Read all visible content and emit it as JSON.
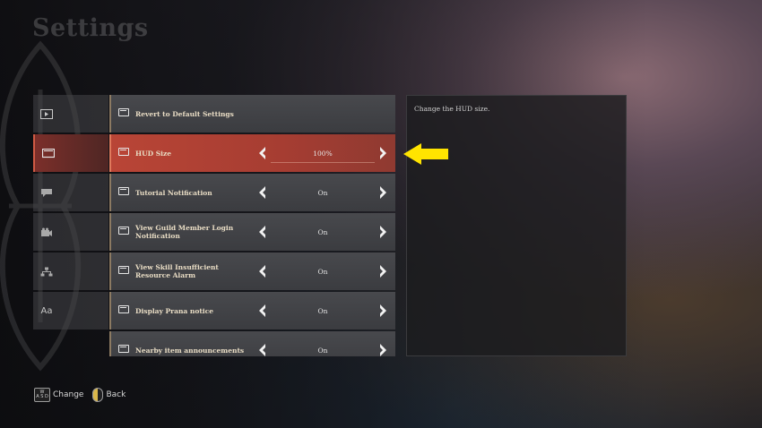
{
  "page": {
    "title": "Settings"
  },
  "sidebar": {
    "items": [
      {
        "icon": "video-icon",
        "active": false
      },
      {
        "icon": "monitor-icon",
        "active": true
      },
      {
        "icon": "chat-bubble-icon",
        "active": false
      },
      {
        "icon": "camera-icon",
        "active": false
      },
      {
        "icon": "network-icon",
        "active": false
      },
      {
        "icon": "text-size-icon",
        "glyph": "Aa",
        "active": false
      }
    ]
  },
  "options": [
    {
      "label": "Revert to Default Settings",
      "value": "",
      "has_arrows": false,
      "active": false
    },
    {
      "label": "HUD Size",
      "value": "100%",
      "has_arrows": true,
      "active": true
    },
    {
      "label": "Tutorial Notification",
      "value": "On",
      "has_arrows": true,
      "active": false
    },
    {
      "label": "View Guild Member Login Notification",
      "value": "On",
      "has_arrows": true,
      "active": false
    },
    {
      "label": "View Skill Insufficient Resource Alarm",
      "value": "On",
      "has_arrows": true,
      "active": false
    },
    {
      "label": "Display Prana notice",
      "value": "On",
      "has_arrows": true,
      "active": false
    },
    {
      "label": "Nearby item announcements",
      "value": "On",
      "has_arrows": true,
      "active": false
    }
  ],
  "description": {
    "text": "Change the HUD size."
  },
  "footer": {
    "change": {
      "key_top": "W",
      "key_bottom": "A S D",
      "label": "Change"
    },
    "back": {
      "label": "Back"
    }
  },
  "colors": {
    "active_row": "#b94536",
    "pointer_arrow": "#ffe400"
  }
}
